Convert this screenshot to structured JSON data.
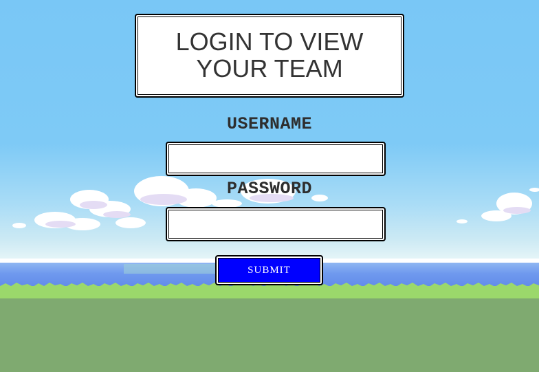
{
  "login": {
    "title": "LOGIN TO VIEW YOUR TEAM",
    "username_label": "USERNAME",
    "username_value": "",
    "password_label": "PASSWORD",
    "password_value": "",
    "submit_label": "SUBMIT"
  },
  "colors": {
    "sky": "#79c7f6",
    "sea": "#6f99ee",
    "grass": "#9bd86b",
    "ground": "#7faa70",
    "submit_button": "#0000ff",
    "title_text": "#333333"
  }
}
